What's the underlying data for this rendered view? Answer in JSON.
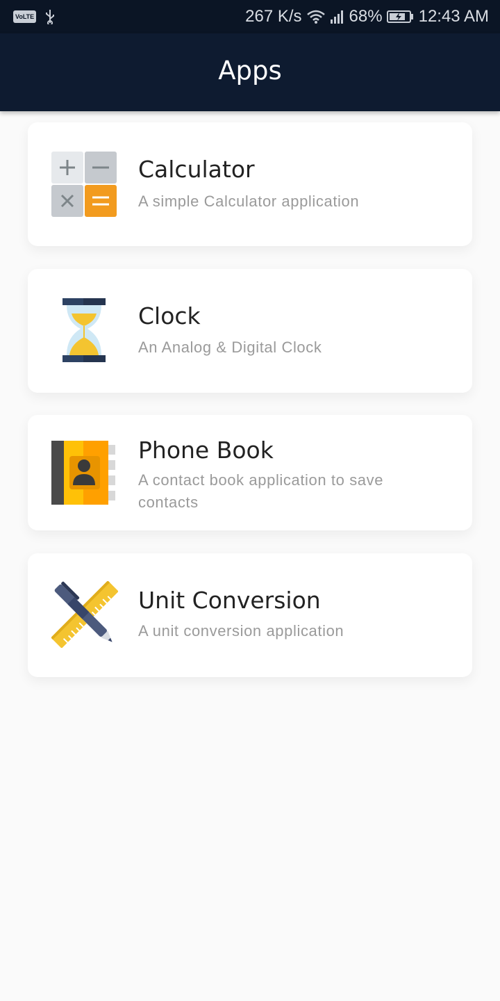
{
  "status_bar": {
    "volte": "VoLTE",
    "net_speed": "267 K/s",
    "battery_percent": "68%",
    "time": "12:43 AM"
  },
  "app_bar": {
    "title": "Apps"
  },
  "apps": [
    {
      "title": "Calculator",
      "description": "A simple Calculator application",
      "icon": "calculator-icon"
    },
    {
      "title": "Clock",
      "description": "An Analog & Digital Clock",
      "icon": "hourglass-icon"
    },
    {
      "title": "Phone Book",
      "description": "A contact book application to save contacts",
      "icon": "contact-book-icon"
    },
    {
      "title": "Unit Conversion",
      "description": "A unit conversion application",
      "icon": "ruler-pen-icon"
    }
  ],
  "colors": {
    "app_bar_bg": "#0e1b30",
    "status_bar_bg": "#0b1525",
    "page_bg": "#fafafa",
    "accent_orange": "#f29b1f"
  }
}
